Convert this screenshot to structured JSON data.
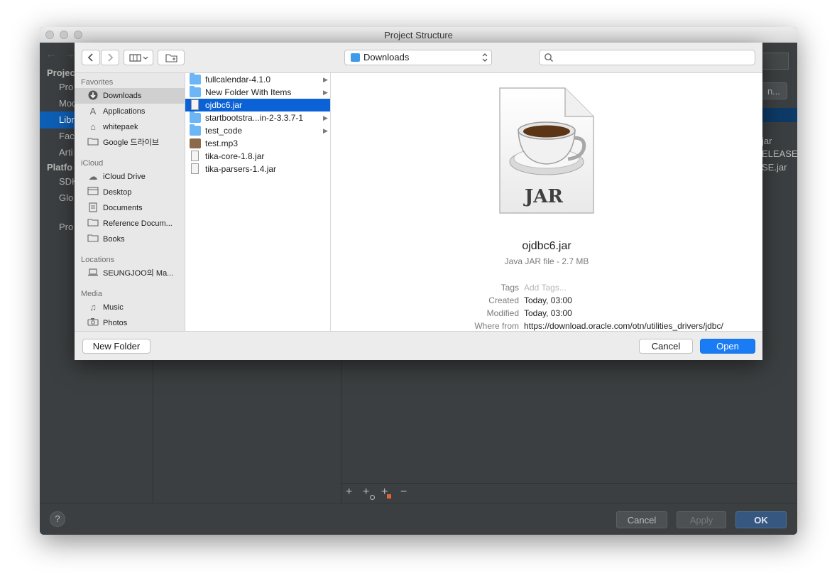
{
  "window": {
    "title": "Project Structure"
  },
  "ide": {
    "nav_fragments": [
      "Projec",
      "Pro",
      "Mod",
      "Libr",
      "Face",
      "Arti",
      "Platfo",
      "SDK",
      "Glo",
      "Pro"
    ],
    "right_fragments": [
      "jar",
      "ELEASE.j",
      "SE.jar"
    ],
    "truncated_button": "n...",
    "pane_tools": [
      "+",
      "+",
      "+",
      "−"
    ],
    "help_label": "?",
    "buttons": {
      "cancel": "Cancel",
      "apply": "Apply",
      "ok": "OK"
    }
  },
  "dialog": {
    "location": "Downloads",
    "search_placeholder": "",
    "sidebar": {
      "sections": [
        {
          "header": "Favorites",
          "items": [
            {
              "label": "Downloads",
              "icon": "download-icon",
              "selected": true
            },
            {
              "label": "Applications",
              "icon": "applications-icon"
            },
            {
              "label": "whitepaek",
              "icon": "home-icon"
            },
            {
              "label": "Google 드라이브",
              "icon": "folder-icon"
            }
          ]
        },
        {
          "header": "iCloud",
          "items": [
            {
              "label": "iCloud Drive",
              "icon": "cloud-icon"
            },
            {
              "label": "Desktop",
              "icon": "desktop-icon"
            },
            {
              "label": "Documents",
              "icon": "documents-icon"
            },
            {
              "label": "Reference Docum...",
              "icon": "folder-icon"
            },
            {
              "label": "Books",
              "icon": "folder-icon"
            }
          ]
        },
        {
          "header": "Locations",
          "items": [
            {
              "label": "SEUNGJOO의 Ma...",
              "icon": "laptop-icon"
            }
          ]
        },
        {
          "header": "Media",
          "items": [
            {
              "label": "Music",
              "icon": "music-icon"
            },
            {
              "label": "Photos",
              "icon": "camera-icon"
            }
          ]
        }
      ]
    },
    "files": [
      {
        "name": "fullcalendar-4.1.0",
        "kind": "folder"
      },
      {
        "name": "New Folder With Items",
        "kind": "folder"
      },
      {
        "name": "ojdbc6.jar",
        "kind": "jar",
        "selected": true
      },
      {
        "name": "startbootstra...in-2-3.3.7-1",
        "kind": "folder"
      },
      {
        "name": "test_code",
        "kind": "folder"
      },
      {
        "name": "test.mp3",
        "kind": "audio"
      },
      {
        "name": "tika-core-1.8.jar",
        "kind": "jar"
      },
      {
        "name": "tika-parsers-1.4.jar",
        "kind": "jar"
      }
    ],
    "preview": {
      "icon_label": "JAR",
      "filename": "ojdbc6.jar",
      "kind_size": "Java JAR file - 2.7 MB",
      "meta": [
        {
          "key": "Tags",
          "value": "Add Tags...",
          "placeholder": true
        },
        {
          "key": "Created",
          "value": "Today, 03:00"
        },
        {
          "key": "Modified",
          "value": "Today, 03:00"
        },
        {
          "key": "Where from",
          "value": "https://download.oracle.com/otn/utilities_drivers/jdbc/"
        }
      ]
    },
    "buttons": {
      "new_folder": "New Folder",
      "cancel": "Cancel",
      "open": "Open"
    }
  }
}
